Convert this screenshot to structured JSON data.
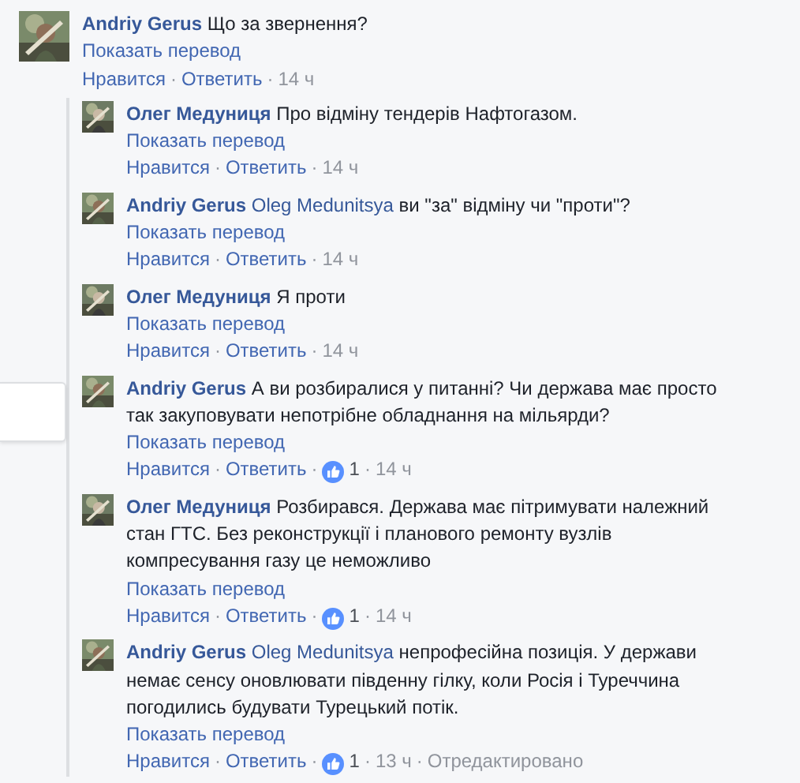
{
  "comments": [
    {
      "author": "Andriy Gerus",
      "text": "Що за звернення?",
      "translate": "Показать перевод",
      "like": "Нравится",
      "sep": "·",
      "reply": "Ответить",
      "time": "14 ч",
      "replies": [
        {
          "author": "Олег Медуниця",
          "text": "Про відміну тендерів Нафтогазом.",
          "translate": "Показать перевод",
          "like": "Нравится",
          "sep": "·",
          "reply": "Ответить",
          "time": "14 ч"
        },
        {
          "author": "Andriy Gerus",
          "mention": "Oleg Medunitsya",
          "text": "ви \"за\" відміну чи \"проти\"?",
          "translate": "Показать перевод",
          "like": "Нравится",
          "sep": "·",
          "reply": "Ответить",
          "time": "14 ч"
        },
        {
          "author": "Олег Медуниця",
          "text": "Я проти",
          "translate": "Показать перевод",
          "like": "Нравится",
          "sep": "·",
          "reply": "Ответить",
          "time": "14 ч"
        },
        {
          "author": "Andriy Gerus",
          "text": "А ви розбиралися у питанні? Чи держава має просто так закуповувати непотрібне обладнання на мільярди?",
          "translate": "Показать перевод",
          "like": "Нравится",
          "sep": "·",
          "reply": "Ответить",
          "likes": "1",
          "time": "14 ч"
        },
        {
          "author": "Олег Медуниця",
          "text": "Розбирався. Держава має пітримувати належний стан ГТС. Без реконструкції і планового ремонту вузлів компресування газу це неможливо",
          "translate": "Показать перевод",
          "like": "Нравится",
          "sep": "·",
          "reply": "Ответить",
          "likes": "1",
          "time": "14 ч"
        },
        {
          "author": "Andriy Gerus",
          "mention": "Oleg Medunitsya",
          "text": "непрофесійна позиція. У держави немає сенсу оновлювати південну гілку, коли Росія і Туреччина погодились будувати Турецький потік.",
          "translate": "Показать перевод",
          "like": "Нравится",
          "sep": "·",
          "reply": "Ответить",
          "likes": "1",
          "time": "13 ч",
          "edited": "Отредактировано"
        }
      ]
    }
  ]
}
